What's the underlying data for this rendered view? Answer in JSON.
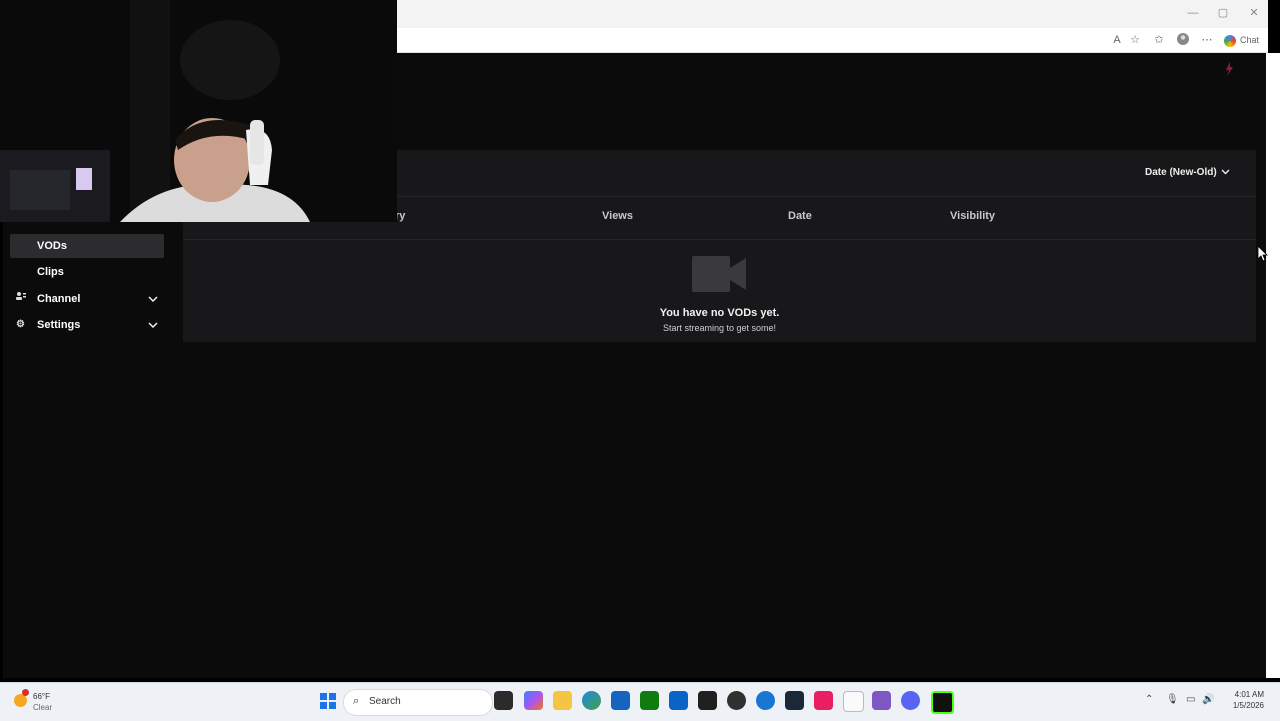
{
  "browser": {
    "window_controls": {
      "minimize": "—",
      "restore": "▢",
      "close": "✕"
    },
    "toolbar_icons": [
      "read-aloud-icon",
      "favorite-star-icon",
      "favorites-icon",
      "profile-icon",
      "more-icon"
    ],
    "chat_label": "Chat"
  },
  "sidebar": {
    "items": [
      {
        "label": "VODs",
        "active": true,
        "icon": null,
        "expandable": false
      },
      {
        "label": "Clips",
        "active": false,
        "icon": null,
        "expandable": false
      },
      {
        "label": "Channel",
        "active": false,
        "icon": "channel-icon",
        "expandable": true
      },
      {
        "label": "Settings",
        "active": false,
        "icon": "gear-icon",
        "expandable": true
      }
    ]
  },
  "vods": {
    "sort_label": "Date (New-Old)",
    "columns": [
      "ry",
      "Views",
      "Date",
      "Visibility"
    ],
    "empty_title": "You have no VODs yet.",
    "empty_subtitle": "Start streaming to get some!"
  },
  "taskbar": {
    "weather_temp": "66°F",
    "weather_condition": "Clear",
    "search_placeholder": "Search",
    "time": "4:01 AM",
    "date": "1/5/2026",
    "apps": [
      "file-explorer-icon",
      "copilot-icon",
      "folder-icon",
      "edge-icon",
      "store-icon",
      "xbox-icon",
      "outlook-icon",
      "app-icon",
      "obs-icon",
      "browser-icon",
      "steam-icon",
      "tiktok-icon",
      "notepad-icon",
      "game-icon",
      "discord-icon",
      "kick-icon"
    ]
  }
}
